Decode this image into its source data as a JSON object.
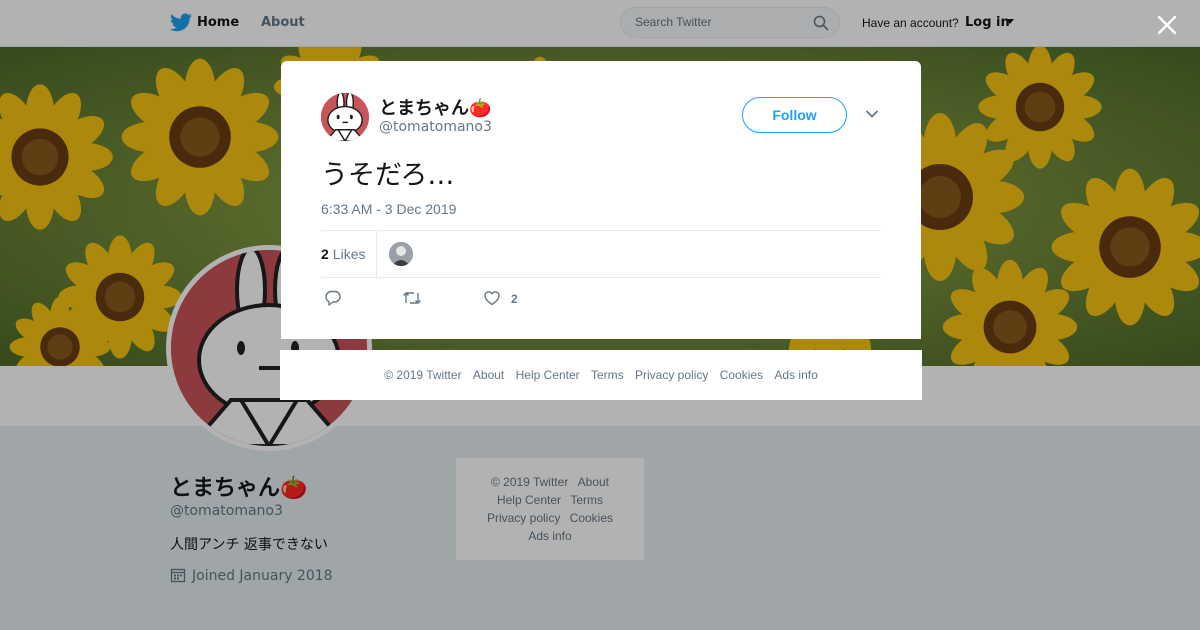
{
  "topbar": {
    "home_label": "Home",
    "about_label": "About",
    "search_placeholder": "Search Twitter",
    "have_account": "Have an account?",
    "login_label": "Log in"
  },
  "profile": {
    "name": "とまちゃん🍅",
    "handle": "@tomatomano3",
    "bio": "人間アンチ 返事できない",
    "joined": "Joined January 2018"
  },
  "side_footer": {
    "copyright": "© 2019 Twitter",
    "about": "About",
    "help_center": "Help Center",
    "terms": "Terms",
    "privacy": "Privacy policy",
    "cookies": "Cookies",
    "ads_info": "Ads info"
  },
  "tweet": {
    "name": "とまちゃん🍅",
    "handle": "@tomatomano3",
    "follow_label": "Follow",
    "text": "うそだろ…",
    "timestamp": "6:33 AM - 3 Dec 2019",
    "likes_count": "2",
    "likes_label": "Likes",
    "like_action_count": "2"
  },
  "modal_footer": {
    "copyright": "© 2019 Twitter",
    "about": "About",
    "help_center": "Help Center",
    "terms": "Terms",
    "privacy": "Privacy policy",
    "cookies": "Cookies",
    "ads_info": "Ads info"
  },
  "colors": {
    "accent": "#1da1f2",
    "avatar_bg": "#c9545a",
    "banner_flower": "#f4c20d"
  },
  "icons": [
    "twitter-bird-icon",
    "search-icon",
    "caret-down-icon",
    "close-icon",
    "chevron-down-icon",
    "calendar-icon",
    "reply-icon",
    "retweet-icon",
    "heart-icon"
  ]
}
